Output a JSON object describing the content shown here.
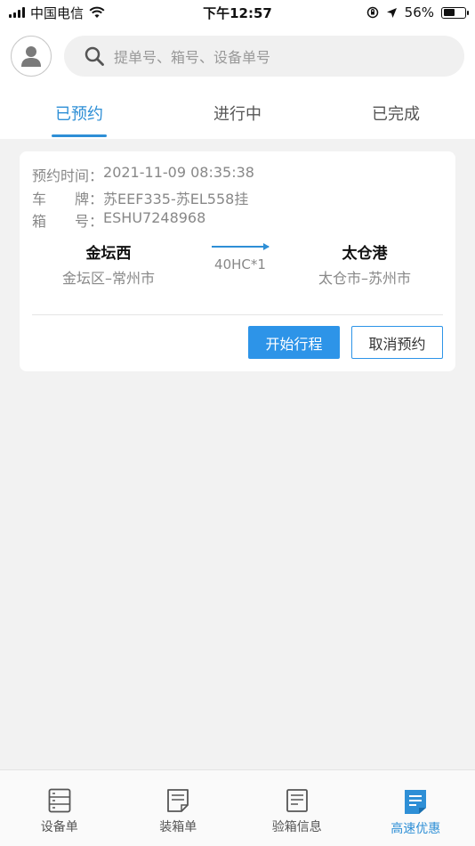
{
  "status_bar": {
    "carrier": "中国电信",
    "time": "下午12:57",
    "battery_percent": "56%",
    "battery_level": 0.56
  },
  "header": {
    "search_placeholder": "提单号、箱号、设备单号"
  },
  "tabs": [
    {
      "label": "已预约",
      "active": true
    },
    {
      "label": "进行中",
      "active": false
    },
    {
      "label": "已完成",
      "active": false
    }
  ],
  "card": {
    "time_label": "预约时间：",
    "time_value": "2021-11-09 08:35:38",
    "plate_label": "车　　牌：",
    "plate_value": "苏EEF335-苏EL558挂",
    "box_label": "箱　　号：",
    "box_value": "ESHU7248968",
    "from_name": "金坛西",
    "from_sub": "金坛区–常州市",
    "spec": "40HC*1",
    "to_name": "太仓港",
    "to_sub": "太仓市–苏州市",
    "start_button": "开始行程",
    "cancel_button": "取消预约"
  },
  "bottom_nav": [
    {
      "label": "设备单",
      "icon": "list-icon",
      "active": false
    },
    {
      "label": "装箱单",
      "icon": "document-icon",
      "active": false
    },
    {
      "label": "验箱信息",
      "icon": "document-icon",
      "active": false
    },
    {
      "label": "高速优惠",
      "icon": "document-icon",
      "active": true
    }
  ],
  "colors": {
    "accent": "#2e8fd6",
    "button": "#2d94e8"
  }
}
